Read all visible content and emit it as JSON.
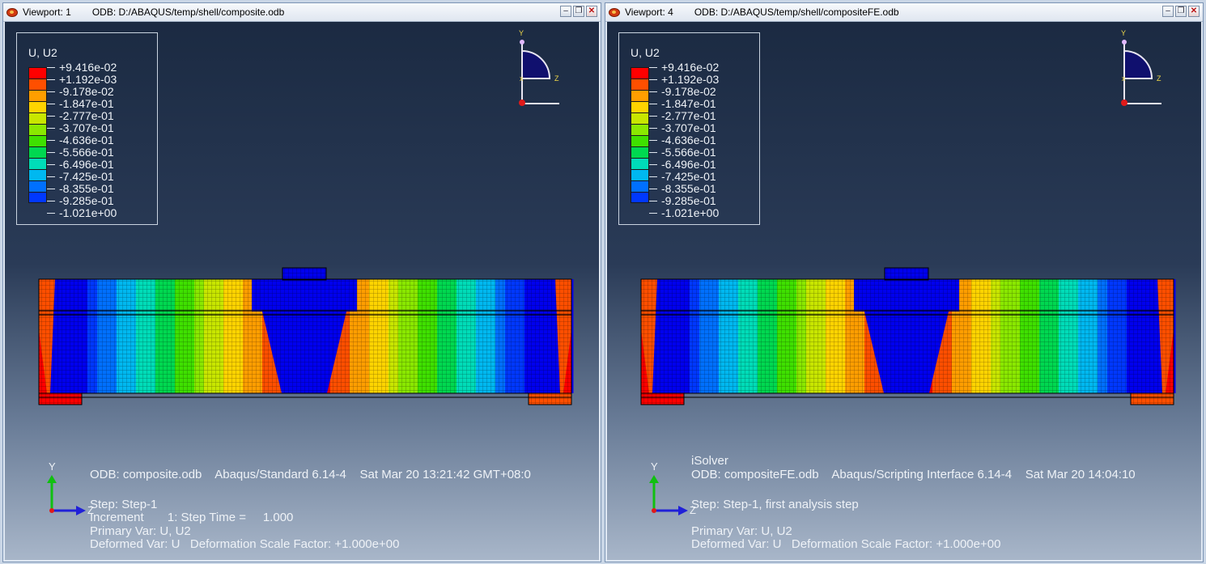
{
  "viewports": [
    {
      "title": "Viewport: 1",
      "odb_path": "ODB: D:/ABAQUS/temp/shell/composite.odb",
      "legend": {
        "title": "U, U2",
        "colors": [
          "#ff0000",
          "#ff4f00",
          "#ff9e00",
          "#ffd400",
          "#c8e600",
          "#8ae800",
          "#3fe000",
          "#00d850",
          "#00dcb8",
          "#00b8f0",
          "#0070ff",
          "#0038ff",
          "#0000ee"
        ],
        "values": [
          "+9.416e-02",
          "+1.192e-03",
          "-9.178e-02",
          "-1.847e-01",
          "-2.777e-01",
          "-3.707e-01",
          "-4.636e-01",
          "-5.566e-01",
          "-6.496e-01",
          "-7.425e-01",
          "-8.355e-01",
          "-9.285e-01",
          "-1.021e+00"
        ]
      },
      "triad": {
        "y": "Y",
        "z": "Z"
      },
      "info": {
        "solver": "",
        "line1": "ODB: composite.odb    Abaqus/Standard 6.14-4    Sat Mar 20 13:21:42 GMT+08:0",
        "line2": "Step: Step-1",
        "line3": "Increment       1: Step Time =     1.000",
        "line4": "Primary Var: U, U2",
        "line5": "Deformed Var: U   Deformation Scale Factor: +1.000e+00"
      }
    },
    {
      "title": "Viewport: 4",
      "odb_path": "ODB: D:/ABAQUS/temp/shell/compositeFE.odb",
      "legend": {
        "title": "U, U2",
        "colors": [
          "#ff0000",
          "#ff4f00",
          "#ff9e00",
          "#ffd400",
          "#c8e600",
          "#8ae800",
          "#3fe000",
          "#00d850",
          "#00dcb8",
          "#00b8f0",
          "#0070ff",
          "#0038ff",
          "#0000ee"
        ],
        "values": [
          "+9.416e-02",
          "+1.192e-03",
          "-9.178e-02",
          "-1.847e-01",
          "-2.777e-01",
          "-3.707e-01",
          "-4.636e-01",
          "-5.566e-01",
          "-6.496e-01",
          "-7.425e-01",
          "-8.355e-01",
          "-9.285e-01",
          "-1.021e+00"
        ]
      },
      "triad": {
        "y": "Y",
        "z": "Z"
      },
      "info": {
        "solver": "iSolver",
        "line1": "ODB: compositeFE.odb    Abaqus/Scripting Interface 6.14-4    Sat Mar 20 14:04:10",
        "line2": "Step: Step-1, first analysis step",
        "line3": "",
        "line4": "Primary Var: U, U2",
        "line5": "Deformed Var: U   Deformation Scale Factor: +1.000e+00"
      }
    }
  ],
  "window_buttons": {
    "minimize": "–",
    "restore": "❐",
    "close": "✕"
  }
}
